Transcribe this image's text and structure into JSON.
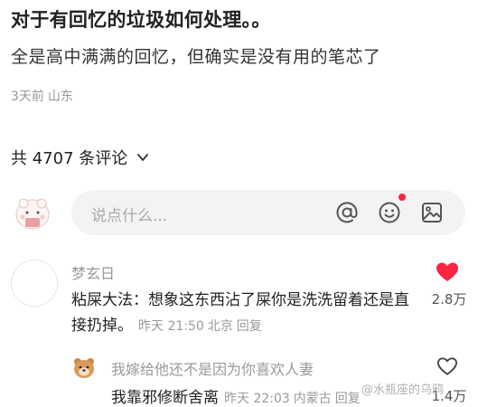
{
  "post": {
    "title": "对于有回忆的垃圾如何处理。。",
    "body": "全是高中满满的回忆，但确实是没有用的笔芯了",
    "time": "3天前",
    "location": "山东"
  },
  "comments_header": {
    "count_label": "共 4707 条评论",
    "icon": "chevron-down-icon"
  },
  "comment_input": {
    "placeholder": "说点什么...",
    "icons": [
      "at-icon",
      "emoji-icon",
      "image-icon"
    ],
    "notification_dot_color": "#ff2442"
  },
  "comments": [
    {
      "username": "梦玄日",
      "text": "粘屎大法：想象这东西沾了屎你是洗洗留着还是直接扔掉。",
      "time": "昨天 21:50",
      "location": "北京",
      "reply_label": "回复",
      "likes": "2.8万",
      "liked": true,
      "like_color": "#ff2442"
    }
  ],
  "replies": [
    {
      "username": "我嫁给他还不是因为你喜欢人妻",
      "text": "我靠邪修断舍离",
      "time": "昨天 22:03",
      "location": "内蒙古",
      "reply_label": "回复",
      "likes": "1.4万",
      "liked": false
    }
  ],
  "watermark": "@水瓶座的乌鸦"
}
